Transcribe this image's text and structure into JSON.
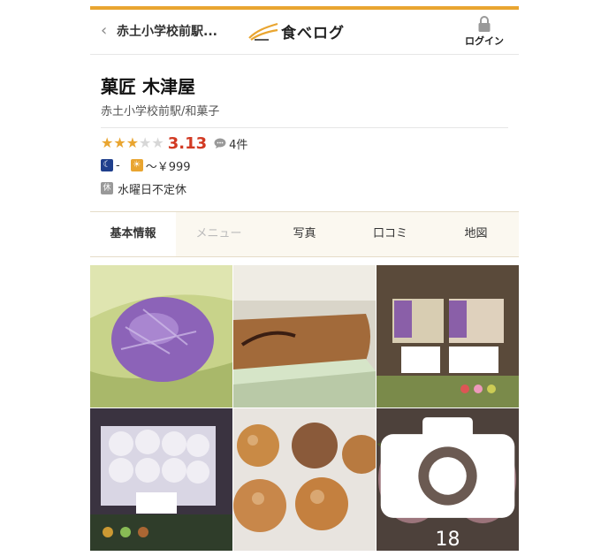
{
  "header": {
    "back_icon": "chevron-left-icon",
    "station": "赤土小学校前駅...",
    "logo_text": "食べログ",
    "login_label": "ログイン"
  },
  "shop": {
    "name": "菓匠 木津屋",
    "genre": "赤土小学校前駅/和菓子",
    "rating": {
      "stars_filled": 3,
      "stars_total": 5,
      "score": "3.13",
      "reviews": "4件"
    },
    "budget": {
      "dinner_icon": "☾",
      "dinner": "-",
      "lunch_icon": "☀",
      "lunch": "～￥999"
    },
    "holiday_icon": "休",
    "holiday": "水曜日不定休"
  },
  "tabs": [
    {
      "label": "基本情報",
      "active": true
    },
    {
      "label": "メニュー",
      "disabled": true
    },
    {
      "label": "写真"
    },
    {
      "label": "口コミ"
    },
    {
      "label": "地図"
    }
  ],
  "photos": {
    "more_count": "18"
  },
  "colors": {
    "accent": "#e9a530",
    "score": "#d23a23"
  }
}
